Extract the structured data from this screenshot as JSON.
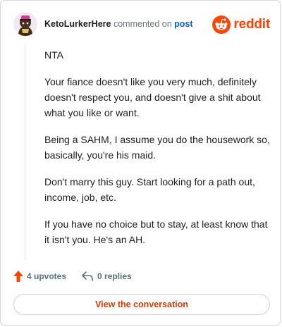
{
  "comment": {
    "username": "KetoLurkerHere",
    "action": "commented on",
    "target_link": "post",
    "paragraphs": [
      "NTA",
      "Your fiance doesn't like you very much, definitely doesn't respect you, and doesn't give a shit about what you like or want.",
      "Being a SAHM, I assume you do the housework so, basically, you're his maid.",
      "Don't marry this guy. Start looking for a path out, income, job, etc.",
      "If you have no choice but to stay, at least know that it isn't you. He's an AH."
    ]
  },
  "brand": {
    "name": "reddit",
    "color": "#ff4500"
  },
  "footer": {
    "upvotes_label": "4 upvotes",
    "replies_label": "0 replies",
    "upvote_icon": "upvote-arrow-icon",
    "reply_icon": "reply-arrow-icon"
  },
  "cta": {
    "label": "View the conversation"
  }
}
